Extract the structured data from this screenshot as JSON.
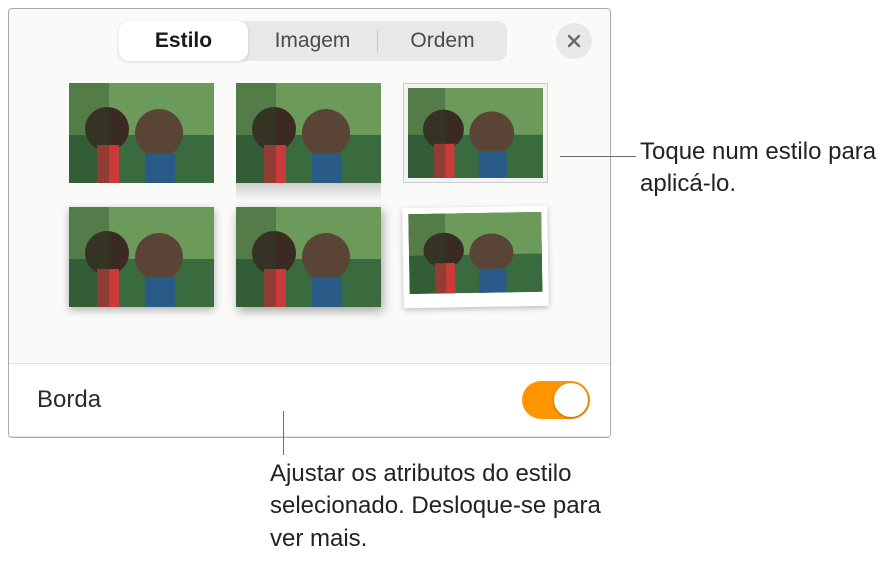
{
  "tabs": {
    "style": "Estilo",
    "image": "Imagem",
    "order": "Ordem"
  },
  "selected_tab": "style",
  "styles": [
    {
      "name": "plain"
    },
    {
      "name": "reflection"
    },
    {
      "name": "frame"
    },
    {
      "name": "shadow1"
    },
    {
      "name": "shadow2"
    },
    {
      "name": "photo"
    }
  ],
  "border_row": {
    "label": "Borda",
    "enabled": true
  },
  "callouts": {
    "style_tap": "Toque num estilo para aplicá-lo.",
    "attributes": "Ajustar os atributos do estilo selecionado. Desloque-se para ver mais."
  }
}
